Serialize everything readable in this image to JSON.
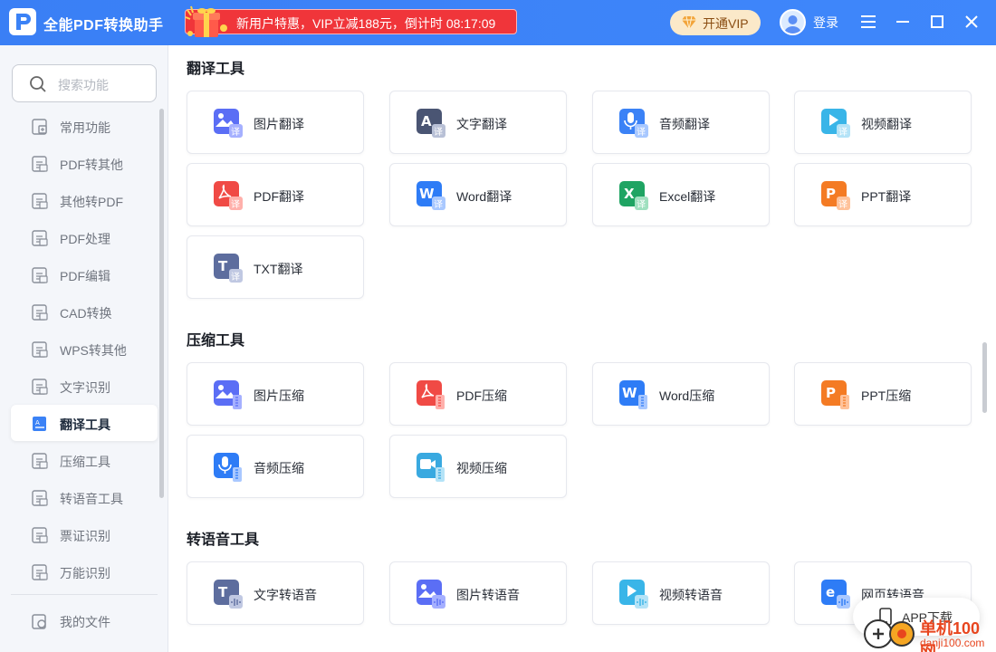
{
  "app": {
    "title": "全能PDF转换助手"
  },
  "promo": {
    "text": "新用户特惠，VIP立减188元，倒计时 08:17:09"
  },
  "header": {
    "vip_label": "开通VIP",
    "login_label": "登录"
  },
  "colors": {
    "brand": "#3b82f6",
    "promo": "#f0353a",
    "vip_bg": "#fbe9c9"
  },
  "search": {
    "placeholder": "搜索功能"
  },
  "sidebar": {
    "items": [
      {
        "label": "常用功能",
        "icon": "grid-icon"
      },
      {
        "label": "PDF转其他",
        "icon": "pdf-convert-icon"
      },
      {
        "label": "其他转PDF",
        "icon": "to-pdf-icon"
      },
      {
        "label": "PDF处理",
        "icon": "pdf-process-icon"
      },
      {
        "label": "PDF编辑",
        "icon": "pdf-edit-icon"
      },
      {
        "label": "CAD转换",
        "icon": "cad-icon"
      },
      {
        "label": "WPS转其他",
        "icon": "wps-icon"
      },
      {
        "label": "文字识别",
        "icon": "ocr-icon"
      },
      {
        "label": "翻译工具",
        "icon": "translate-icon",
        "active": true
      },
      {
        "label": "压缩工具",
        "icon": "zip-icon"
      },
      {
        "label": "转语音工具",
        "icon": "speech-icon"
      },
      {
        "label": "票证识别",
        "icon": "ticket-icon"
      },
      {
        "label": "万能识别",
        "icon": "scan-icon"
      }
    ],
    "footer_item": {
      "label": "我的文件",
      "icon": "folder-icon"
    }
  },
  "sections": [
    {
      "title": "翻译工具",
      "cards": [
        {
          "label": "图片翻译",
          "icon": "image-translate-icon"
        },
        {
          "label": "文字翻译",
          "icon": "text-translate-icon"
        },
        {
          "label": "音频翻译",
          "icon": "audio-translate-icon"
        },
        {
          "label": "视频翻译",
          "icon": "video-translate-icon"
        },
        {
          "label": "PDF翻译",
          "icon": "pdf-translate-icon"
        },
        {
          "label": "Word翻译",
          "icon": "word-translate-icon"
        },
        {
          "label": "Excel翻译",
          "icon": "excel-translate-icon"
        },
        {
          "label": "PPT翻译",
          "icon": "ppt-translate-icon"
        },
        {
          "label": "TXT翻译",
          "icon": "txt-translate-icon"
        }
      ]
    },
    {
      "title": "压缩工具",
      "cards": [
        {
          "label": "图片压缩",
          "icon": "image-compress-icon"
        },
        {
          "label": "PDF压缩",
          "icon": "pdf-compress-icon"
        },
        {
          "label": "Word压缩",
          "icon": "word-compress-icon"
        },
        {
          "label": "PPT压缩",
          "icon": "ppt-compress-icon"
        },
        {
          "label": "音频压缩",
          "icon": "audio-compress-icon"
        },
        {
          "label": "视频压缩",
          "icon": "video-compress-icon"
        }
      ]
    },
    {
      "title": "转语音工具",
      "cards": [
        {
          "label": "文字转语音",
          "icon": "text-to-speech-icon"
        },
        {
          "label": "图片转语音",
          "icon": "image-to-speech-icon"
        },
        {
          "label": "视频转语音",
          "icon": "video-to-speech-icon"
        },
        {
          "label": "网页转语音",
          "icon": "web-to-speech-icon"
        }
      ]
    }
  ],
  "app_download": {
    "label": "APP下载"
  },
  "watermark": {
    "line1": "单机100网",
    "line2": "danji100.com"
  }
}
